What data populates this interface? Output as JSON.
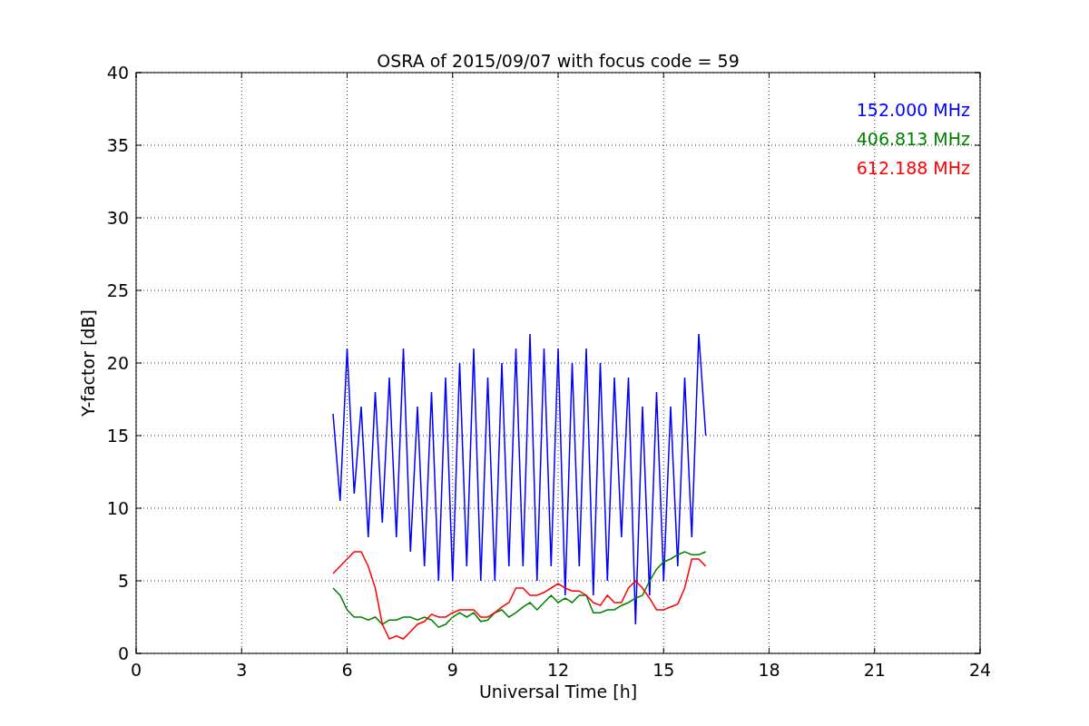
{
  "chart_data": {
    "type": "line",
    "title": "OSRA of 2015/09/07 with focus code = 59",
    "xlabel": "Universal Time [h]",
    "ylabel": "Y-factor [dB]",
    "x": [
      5.6,
      5.8,
      6.0,
      6.2,
      6.4,
      6.6,
      6.8,
      7.0,
      7.2,
      7.4,
      7.6,
      7.8,
      8.0,
      8.2,
      8.4,
      8.6,
      8.8,
      9.0,
      9.2,
      9.4,
      9.6,
      9.8,
      10.0,
      10.2,
      10.4,
      10.6,
      10.8,
      11.0,
      11.2,
      11.4,
      11.6,
      11.8,
      12.0,
      12.2,
      12.4,
      12.6,
      12.8,
      13.0,
      13.2,
      13.4,
      13.6,
      13.8,
      14.0,
      14.2,
      14.4,
      14.6,
      14.8,
      15.0,
      15.2,
      15.4,
      15.6,
      15.8,
      16.0,
      16.2
    ],
    "series": [
      {
        "name": "152.000 MHz",
        "color": "#0000ff",
        "values": [
          16.5,
          10.5,
          21,
          11,
          17,
          8,
          18,
          9,
          19,
          8,
          21,
          7,
          17,
          6,
          18,
          5,
          19,
          5,
          20,
          6,
          21,
          5,
          19,
          5,
          20,
          6,
          21,
          6,
          22,
          5,
          21,
          6,
          21,
          4,
          20,
          6,
          21,
          4,
          20,
          5,
          19,
          8,
          19,
          2,
          17,
          4,
          18,
          5,
          17,
          6,
          19,
          8,
          22,
          15
        ]
      },
      {
        "name": "406.813 MHz",
        "color": "#008000",
        "values": [
          4.5,
          4,
          3,
          2.5,
          2.5,
          2.3,
          2.5,
          2,
          2.3,
          2.3,
          2.5,
          2.5,
          2.3,
          2.5,
          2.3,
          1.8,
          2,
          2.5,
          2.8,
          2.5,
          2.8,
          2.2,
          2.3,
          2.8,
          3,
          2.5,
          2.8,
          3.2,
          3.5,
          3,
          3.5,
          4,
          3.5,
          3.8,
          3.5,
          4,
          4,
          2.8,
          2.8,
          3,
          3,
          3.3,
          3.5,
          3.8,
          4,
          5,
          5.8,
          6.3,
          6.5,
          6.8,
          7,
          6.8,
          6.8,
          7
        ]
      },
      {
        "name": "612.188 MHz",
        "color": "#ff0000",
        "values": [
          5.5,
          6,
          6.5,
          7,
          7,
          6,
          4.5,
          2,
          1,
          1.2,
          1,
          1.5,
          2,
          2.2,
          2.7,
          2.5,
          2.5,
          2.8,
          3,
          3,
          3,
          2.5,
          2.5,
          2.8,
          3.2,
          3.5,
          4.5,
          4.5,
          4,
          4,
          4.2,
          4.5,
          4.8,
          4.5,
          4.3,
          4.3,
          4,
          3.5,
          3.3,
          4,
          3.5,
          3.5,
          4.5,
          5,
          4.5,
          3.8,
          3,
          3,
          3.2,
          3.4,
          4.5,
          6.5,
          6.5,
          6
        ]
      }
    ],
    "grid": true,
    "xlim": [
      0,
      24
    ],
    "ylim": [
      0,
      40
    ],
    "xticks": [
      0,
      3,
      6,
      9,
      12,
      15,
      18,
      21,
      24
    ],
    "yticks": [
      0,
      5,
      10,
      15,
      20,
      25,
      30,
      35,
      40
    ]
  }
}
